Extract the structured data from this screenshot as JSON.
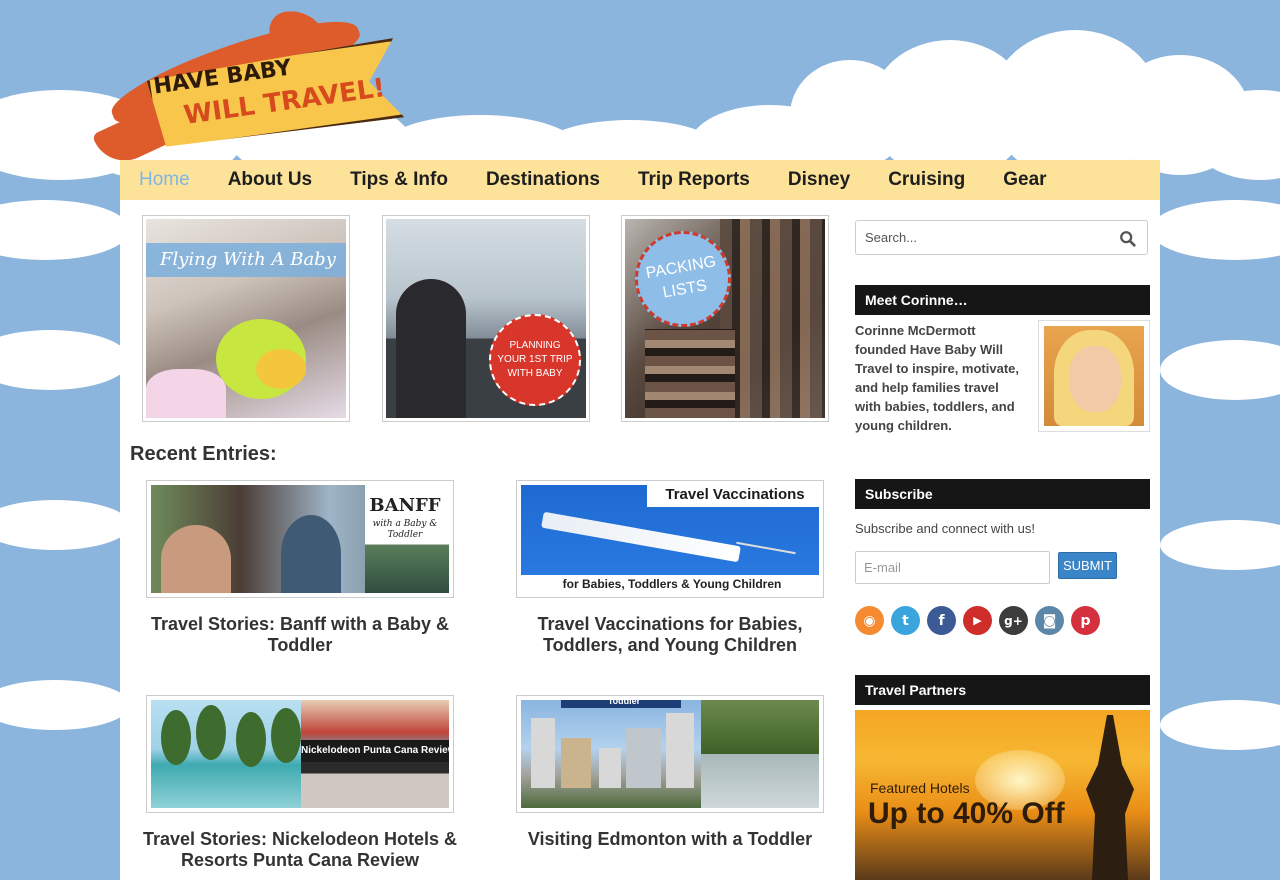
{
  "logo": {
    "line1": "HAVE BABY",
    "line2": "WILL TRAVEL!"
  },
  "nav": {
    "items": [
      {
        "label": "Home"
      },
      {
        "label": "About Us"
      },
      {
        "label": "Tips & Info"
      },
      {
        "label": "Destinations"
      },
      {
        "label": "Trip Reports"
      },
      {
        "label": "Disney"
      },
      {
        "label": "Cruising"
      },
      {
        "label": "Gear"
      }
    ],
    "active": "Home"
  },
  "featured": [
    {
      "overlay": "Flying With A Baby"
    },
    {
      "overlay": "PLANNING YOUR 1ST TRIP WITH BABY"
    },
    {
      "overlay": "PACKING LISTS"
    }
  ],
  "recent": {
    "heading": "Recent Entries:",
    "entries": [
      {
        "title": "Travel Stories: Banff with a Baby & Toddler",
        "thumb_text": "BANFF",
        "thumb_sub": "with a Baby & Toddler"
      },
      {
        "title": "Travel Vaccinations for Babies, Toddlers, and Young Children",
        "thumb_text": "Travel Vaccinations",
        "thumb_sub": "for Babies, Toddlers & Young Children"
      },
      {
        "title": "Travel Stories: Nickelodeon Hotels & Resorts Punta Cana Review",
        "thumb_text": "Nickelodeon Punta Cana Review"
      },
      {
        "title": "Visiting Edmonton with a Toddler",
        "thumb_text": "Toddler"
      }
    ]
  },
  "sidebar": {
    "search": {
      "placeholder": "Search..."
    },
    "meet": {
      "heading": "Meet Corinne…",
      "bio": "Corinne McDermott founded Have Baby Will Travel to inspire, motivate, and help families travel with babies, toddlers, and young children."
    },
    "subscribe": {
      "heading": "Subscribe",
      "text": "Subscribe and connect with us!",
      "email_placeholder": "E-mail",
      "button": "SUBMIT"
    },
    "social": [
      {
        "icon": "rss-icon",
        "glyph": "◉",
        "color": "#f58a31"
      },
      {
        "icon": "twitter-icon",
        "glyph": "t",
        "color": "#3aa4dd"
      },
      {
        "icon": "facebook-icon",
        "glyph": "f",
        "color": "#3b5a96"
      },
      {
        "icon": "youtube-icon",
        "glyph": "▶",
        "color": "#cf2d2a"
      },
      {
        "icon": "google-plus-icon",
        "glyph": "g+",
        "color": "#3c3c3c"
      },
      {
        "icon": "instagram-icon",
        "glyph": "◙",
        "color": "#5d87a8"
      },
      {
        "icon": "pinterest-icon",
        "glyph": "p",
        "color": "#d4303e"
      }
    ],
    "partners": {
      "heading": "Travel Partners",
      "ad_line1": "Featured Hotels",
      "ad_line2": "Up to 40% Off"
    }
  }
}
